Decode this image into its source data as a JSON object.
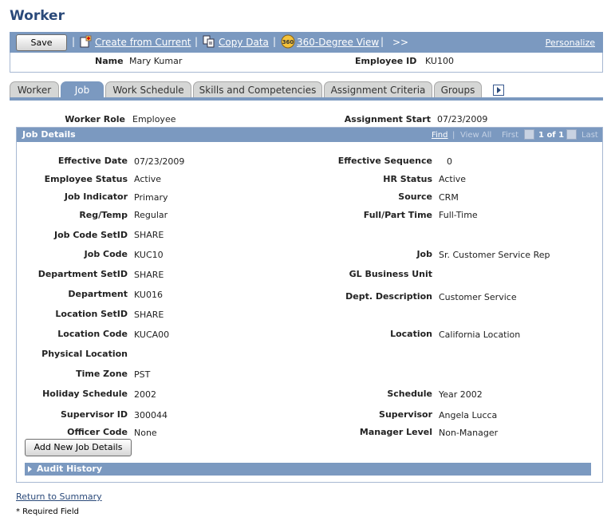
{
  "page": {
    "title": "Worker"
  },
  "toolbar": {
    "save_label": "Save",
    "create_from_current": "Create from Current",
    "copy_data": "Copy Data",
    "view_360": "360-Degree View",
    "more": ">>",
    "personalize": "Personalize",
    "sep": "|",
    "icon_360_text": "360"
  },
  "header": {
    "name_label": "Name",
    "name_value": "Mary Kumar",
    "emp_id_label": "Employee ID",
    "emp_id_value": "KU100"
  },
  "tabs": [
    {
      "label": "Worker",
      "active": false
    },
    {
      "label": "Job",
      "active": true
    },
    {
      "label": "Work Schedule",
      "active": false
    },
    {
      "label": "Skills and Competencies",
      "active": false
    },
    {
      "label": "Assignment Criteria",
      "active": false
    },
    {
      "label": "Groups",
      "active": false
    }
  ],
  "role": {
    "worker_role_label": "Worker Role",
    "worker_role_value": "Employee",
    "assign_start_label": "Assignment Start",
    "assign_start_value": "07/23/2009"
  },
  "group": {
    "title": "Job Details",
    "find": "Find",
    "view_all": "View All",
    "first": "First",
    "count": "1 of 1",
    "last": "Last"
  },
  "left_fields": [
    {
      "label": "Effective Date",
      "value": "07/23/2009"
    },
    {
      "label": "Employee Status",
      "value": "Active"
    },
    {
      "label": "Job Indicator",
      "value": "Primary"
    },
    {
      "label": "Reg/Temp",
      "value": "Regular"
    },
    {
      "label": "Job Code SetID",
      "value": "SHARE"
    },
    {
      "label": "Job Code",
      "value": "KUC10"
    },
    {
      "label": "Department SetID",
      "value": "SHARE"
    },
    {
      "label": "Department",
      "value": "KU016"
    },
    {
      "label": "Location SetID",
      "value": "SHARE"
    },
    {
      "label": "Location Code",
      "value": "KUCA00"
    },
    {
      "label": "Physical Location",
      "value": ""
    },
    {
      "label": "Time Zone",
      "value": "PST"
    },
    {
      "label": "Holiday Schedule",
      "value": "2002"
    },
    {
      "label": "Supervisor ID",
      "value": "300044"
    },
    {
      "label": "Officer Code",
      "value": "None"
    }
  ],
  "right_fields": [
    {
      "label": "Effective Sequence",
      "value": "0"
    },
    {
      "label": "HR Status",
      "value": "Active"
    },
    {
      "label": "Source",
      "value": "CRM"
    },
    {
      "label": "Full/Part Time",
      "value": "Full-Time"
    },
    {
      "label": "Job",
      "value": "Sr. Customer Service Rep"
    },
    {
      "label": "GL Business Unit",
      "value": ""
    },
    {
      "label": "Dept. Description",
      "value": "Customer Service"
    },
    {
      "label": "Location",
      "value": "California Location"
    },
    {
      "label": "Schedule",
      "value": "Year 2002"
    },
    {
      "label": "Supervisor",
      "value": "Angela Lucca"
    },
    {
      "label": "Manager Level",
      "value": "Non-Manager"
    }
  ],
  "buttons": {
    "add_new": "Add New Job Details"
  },
  "audit": {
    "label": "Audit History"
  },
  "footer": {
    "return_link": "Return to Summary",
    "required": "* Required Field"
  }
}
